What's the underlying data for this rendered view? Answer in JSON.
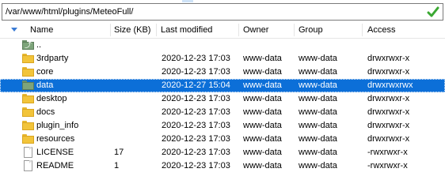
{
  "path": {
    "value": "/var/www/html/plugins/MeteoFull/"
  },
  "columns": {
    "name": "Name",
    "size": "Size (KB)",
    "modified": "Last modified",
    "owner": "Owner",
    "group": "Group",
    "access": "Access"
  },
  "files": [
    {
      "name": "..",
      "size": "",
      "modified": "",
      "owner": "",
      "group": "",
      "access": "",
      "icon": "parent-folder-icon"
    },
    {
      "name": "3rdparty",
      "size": "",
      "modified": "2020-12-23 17:03",
      "owner": "www-data",
      "group": "www-data",
      "access": "drwxrwxr-x",
      "icon": "folder-icon"
    },
    {
      "name": "core",
      "size": "",
      "modified": "2020-12-23 17:03",
      "owner": "www-data",
      "group": "www-data",
      "access": "drwxrwxr-x",
      "icon": "folder-icon"
    },
    {
      "name": "data",
      "size": "",
      "modified": "2020-12-27 15:04",
      "owner": "www-data",
      "group": "www-data",
      "access": "drwxrwxrwx",
      "icon": "folder-icon",
      "selected": true
    },
    {
      "name": "desktop",
      "size": "",
      "modified": "2020-12-23 17:03",
      "owner": "www-data",
      "group": "www-data",
      "access": "drwxrwxr-x",
      "icon": "folder-icon"
    },
    {
      "name": "docs",
      "size": "",
      "modified": "2020-12-23 17:03",
      "owner": "www-data",
      "group": "www-data",
      "access": "drwxrwxr-x",
      "icon": "folder-icon"
    },
    {
      "name": "plugin_info",
      "size": "",
      "modified": "2020-12-23 17:03",
      "owner": "www-data",
      "group": "www-data",
      "access": "drwxrwxr-x",
      "icon": "folder-icon"
    },
    {
      "name": "resources",
      "size": "",
      "modified": "2020-12-23 17:03",
      "owner": "www-data",
      "group": "www-data",
      "access": "drwxrwxr-x",
      "icon": "folder-icon"
    },
    {
      "name": "LICENSE",
      "size": "17",
      "modified": "2020-12-23 17:03",
      "owner": "www-data",
      "group": "www-data",
      "access": "-rwxrwxr-x",
      "icon": "file-icon"
    },
    {
      "name": "README",
      "size": "1",
      "modified": "2020-12-23 17:03",
      "owner": "www-data",
      "group": "www-data",
      "access": "-rwxrwxr-x",
      "icon": "file-icon"
    }
  ],
  "colors": {
    "selection": "#0c6fd8",
    "folder": "#f2c43a",
    "ok_check": "#3aa832"
  }
}
